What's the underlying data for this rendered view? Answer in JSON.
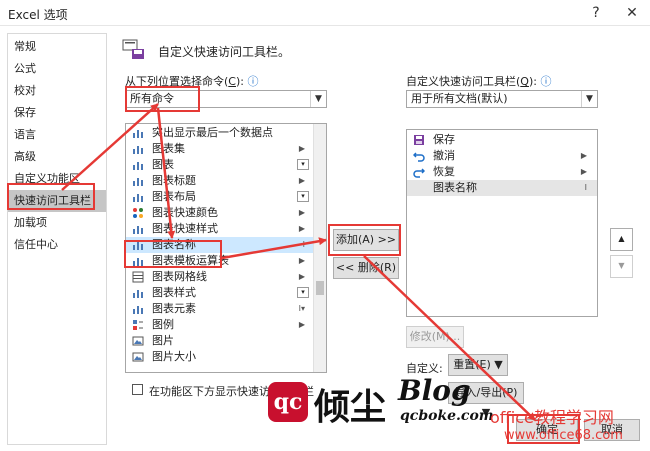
{
  "window": {
    "title": "Excel 选项",
    "help_glyph": "?",
    "close_glyph": "✕"
  },
  "nav": {
    "items": [
      "常规",
      "公式",
      "校对",
      "保存",
      "语言",
      "高级",
      "自定义功能区",
      "快速访问工具栏",
      "加载项",
      "信任中心"
    ],
    "active_index": 7
  },
  "header": {
    "text": "自定义快速访问工具栏。"
  },
  "left_panel": {
    "choose_label_prefix": "从下列位置选择命令(",
    "choose_label_key": "C",
    "choose_label_suffix": "):",
    "info_icon": "ⓘ",
    "dropdown_value": "所有命令",
    "commands": [
      {
        "icon": "chart-icon",
        "label": "突出显示最后一个数据点",
        "marker": ""
      },
      {
        "icon": "chart-icon",
        "label": "图表集",
        "marker": "▶"
      },
      {
        "icon": "chart-icon",
        "label": "图表",
        "marker": "dd"
      },
      {
        "icon": "chart-icon",
        "label": "图表标题",
        "marker": "▶"
      },
      {
        "icon": "chart-icon",
        "label": "图表布局",
        "marker": "dd"
      },
      {
        "icon": "palette-icon",
        "label": "图表快速颜色",
        "marker": "▶"
      },
      {
        "icon": "chart-icon",
        "label": "图表快速样式",
        "marker": "▶"
      },
      {
        "icon": "chart-icon",
        "label": "图表名称",
        "marker": "I",
        "selected": true
      },
      {
        "icon": "chart-icon",
        "label": "图表模板运算表",
        "marker": "▶"
      },
      {
        "icon": "grid-icon",
        "label": "图表网格线",
        "marker": "▶"
      },
      {
        "icon": "chart-icon",
        "label": "图表样式",
        "marker": "dd"
      },
      {
        "icon": "chart-icon",
        "label": "图表元素",
        "marker": "I▾"
      },
      {
        "icon": "legend-icon",
        "label": "图例",
        "marker": "▶"
      },
      {
        "icon": "picture-icon",
        "label": "图片",
        "marker": ""
      },
      {
        "icon": "picture-icon",
        "label": "图片大小",
        "marker": ""
      }
    ],
    "checkbox_label": "在功能区下方显示快速访问工具栏"
  },
  "middle": {
    "add_label": "添加(A) >>",
    "remove_label": "<< 删除(R)"
  },
  "right_panel": {
    "label_prefix": "自定义快速访问工具栏(",
    "label_key": "Q",
    "label_suffix": "):",
    "info_icon": "ⓘ",
    "dropdown_value": "用于所有文档(默认)",
    "items": [
      {
        "icon": "save-icon",
        "label": "保存",
        "marker": ""
      },
      {
        "icon": "undo-icon",
        "label": "撤消",
        "marker": "▶"
      },
      {
        "icon": "redo-icon",
        "label": "恢复",
        "marker": "▶"
      },
      {
        "icon": "",
        "label": "图表名称",
        "marker": "I",
        "highlighted": true
      }
    ],
    "up_glyph": "▲",
    "down_glyph": "▼",
    "modify_label": "修改(M)...",
    "customize_label": "自定义:",
    "reset_label": "重置(E) ▼",
    "import_export_label": "导入/导出(P) ▼"
  },
  "footer": {
    "ok_label": "确定",
    "cancel_label": "取消"
  },
  "watermark": {
    "logo_glyph": "qc",
    "brand": "倾尘",
    "blog": "Blog",
    "domain": "qcboke.com",
    "site_name": "office教程学习网",
    "site_url": "www.office68.com"
  },
  "colors": {
    "annotation_red": "#e53935",
    "selection": "#cde8ff",
    "nav_active": "#c6c6c6"
  }
}
